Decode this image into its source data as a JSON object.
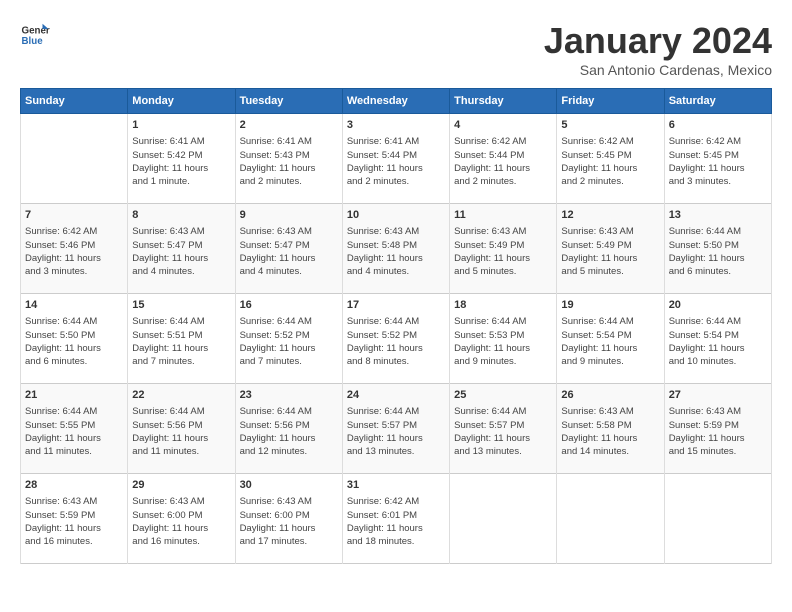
{
  "header": {
    "logo_general": "General",
    "logo_blue": "Blue",
    "month": "January 2024",
    "location": "San Antonio Cardenas, Mexico"
  },
  "days_of_week": [
    "Sunday",
    "Monday",
    "Tuesday",
    "Wednesday",
    "Thursday",
    "Friday",
    "Saturday"
  ],
  "weeks": [
    [
      {
        "day": "",
        "content": ""
      },
      {
        "day": "1",
        "content": "Sunrise: 6:41 AM\nSunset: 5:42 PM\nDaylight: 11 hours\nand 1 minute."
      },
      {
        "day": "2",
        "content": "Sunrise: 6:41 AM\nSunset: 5:43 PM\nDaylight: 11 hours\nand 2 minutes."
      },
      {
        "day": "3",
        "content": "Sunrise: 6:41 AM\nSunset: 5:44 PM\nDaylight: 11 hours\nand 2 minutes."
      },
      {
        "day": "4",
        "content": "Sunrise: 6:42 AM\nSunset: 5:44 PM\nDaylight: 11 hours\nand 2 minutes."
      },
      {
        "day": "5",
        "content": "Sunrise: 6:42 AM\nSunset: 5:45 PM\nDaylight: 11 hours\nand 2 minutes."
      },
      {
        "day": "6",
        "content": "Sunrise: 6:42 AM\nSunset: 5:45 PM\nDaylight: 11 hours\nand 3 minutes."
      }
    ],
    [
      {
        "day": "7",
        "content": "Sunrise: 6:42 AM\nSunset: 5:46 PM\nDaylight: 11 hours\nand 3 minutes."
      },
      {
        "day": "8",
        "content": "Sunrise: 6:43 AM\nSunset: 5:47 PM\nDaylight: 11 hours\nand 4 minutes."
      },
      {
        "day": "9",
        "content": "Sunrise: 6:43 AM\nSunset: 5:47 PM\nDaylight: 11 hours\nand 4 minutes."
      },
      {
        "day": "10",
        "content": "Sunrise: 6:43 AM\nSunset: 5:48 PM\nDaylight: 11 hours\nand 4 minutes."
      },
      {
        "day": "11",
        "content": "Sunrise: 6:43 AM\nSunset: 5:49 PM\nDaylight: 11 hours\nand 5 minutes."
      },
      {
        "day": "12",
        "content": "Sunrise: 6:43 AM\nSunset: 5:49 PM\nDaylight: 11 hours\nand 5 minutes."
      },
      {
        "day": "13",
        "content": "Sunrise: 6:44 AM\nSunset: 5:50 PM\nDaylight: 11 hours\nand 6 minutes."
      }
    ],
    [
      {
        "day": "14",
        "content": "Sunrise: 6:44 AM\nSunset: 5:50 PM\nDaylight: 11 hours\nand 6 minutes."
      },
      {
        "day": "15",
        "content": "Sunrise: 6:44 AM\nSunset: 5:51 PM\nDaylight: 11 hours\nand 7 minutes."
      },
      {
        "day": "16",
        "content": "Sunrise: 6:44 AM\nSunset: 5:52 PM\nDaylight: 11 hours\nand 7 minutes."
      },
      {
        "day": "17",
        "content": "Sunrise: 6:44 AM\nSunset: 5:52 PM\nDaylight: 11 hours\nand 8 minutes."
      },
      {
        "day": "18",
        "content": "Sunrise: 6:44 AM\nSunset: 5:53 PM\nDaylight: 11 hours\nand 9 minutes."
      },
      {
        "day": "19",
        "content": "Sunrise: 6:44 AM\nSunset: 5:54 PM\nDaylight: 11 hours\nand 9 minutes."
      },
      {
        "day": "20",
        "content": "Sunrise: 6:44 AM\nSunset: 5:54 PM\nDaylight: 11 hours\nand 10 minutes."
      }
    ],
    [
      {
        "day": "21",
        "content": "Sunrise: 6:44 AM\nSunset: 5:55 PM\nDaylight: 11 hours\nand 11 minutes."
      },
      {
        "day": "22",
        "content": "Sunrise: 6:44 AM\nSunset: 5:56 PM\nDaylight: 11 hours\nand 11 minutes."
      },
      {
        "day": "23",
        "content": "Sunrise: 6:44 AM\nSunset: 5:56 PM\nDaylight: 11 hours\nand 12 minutes."
      },
      {
        "day": "24",
        "content": "Sunrise: 6:44 AM\nSunset: 5:57 PM\nDaylight: 11 hours\nand 13 minutes."
      },
      {
        "day": "25",
        "content": "Sunrise: 6:44 AM\nSunset: 5:57 PM\nDaylight: 11 hours\nand 13 minutes."
      },
      {
        "day": "26",
        "content": "Sunrise: 6:43 AM\nSunset: 5:58 PM\nDaylight: 11 hours\nand 14 minutes."
      },
      {
        "day": "27",
        "content": "Sunrise: 6:43 AM\nSunset: 5:59 PM\nDaylight: 11 hours\nand 15 minutes."
      }
    ],
    [
      {
        "day": "28",
        "content": "Sunrise: 6:43 AM\nSunset: 5:59 PM\nDaylight: 11 hours\nand 16 minutes."
      },
      {
        "day": "29",
        "content": "Sunrise: 6:43 AM\nSunset: 6:00 PM\nDaylight: 11 hours\nand 16 minutes."
      },
      {
        "day": "30",
        "content": "Sunrise: 6:43 AM\nSunset: 6:00 PM\nDaylight: 11 hours\nand 17 minutes."
      },
      {
        "day": "31",
        "content": "Sunrise: 6:42 AM\nSunset: 6:01 PM\nDaylight: 11 hours\nand 18 minutes."
      },
      {
        "day": "",
        "content": ""
      },
      {
        "day": "",
        "content": ""
      },
      {
        "day": "",
        "content": ""
      }
    ]
  ]
}
